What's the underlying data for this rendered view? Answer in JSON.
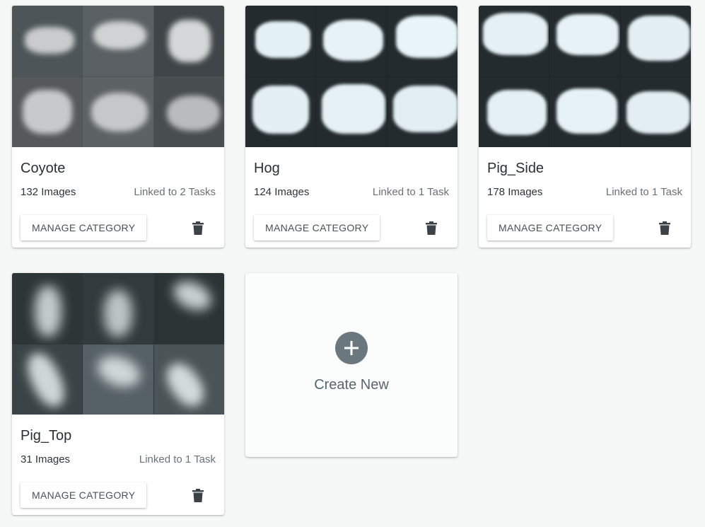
{
  "cards": [
    {
      "name": "Coyote",
      "images": "132 Images",
      "linked": "Linked to 2 Tasks",
      "button": "MANAGE CATEGORY",
      "delete_icon": "trash-icon"
    },
    {
      "name": "Hog",
      "images": "124 Images",
      "linked": "Linked to 1 Task",
      "button": "MANAGE CATEGORY",
      "delete_icon": "trash-icon"
    },
    {
      "name": "Pig_Side",
      "images": "178 Images",
      "linked": "Linked to 1 Task",
      "button": "MANAGE CATEGORY",
      "delete_icon": "trash-icon"
    },
    {
      "name": "Pig_Top",
      "images": "31 Images",
      "linked": "Linked to 1 Task",
      "button": "MANAGE CATEGORY",
      "delete_icon": "trash-icon"
    }
  ],
  "create_new": {
    "label": "Create New",
    "icon": "plus-circle-icon"
  },
  "colors": {
    "background": "#f6f7f7",
    "card": "#ffffff",
    "plus_circle": "#6b777e",
    "thumb_dark": "#232b2e"
  }
}
